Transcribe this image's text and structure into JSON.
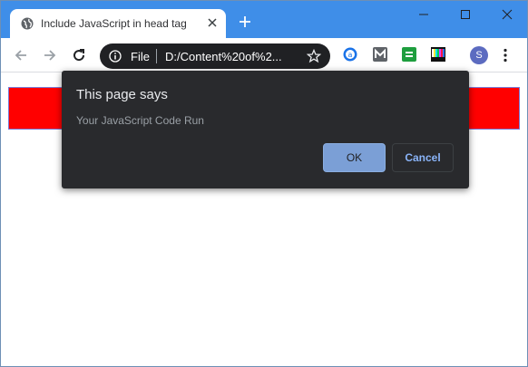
{
  "tab": {
    "title": "Include JavaScript in head tag"
  },
  "address_bar": {
    "scheme_label": "File",
    "url": "D:/Content%20of%2..."
  },
  "profile": {
    "initial": "S"
  },
  "dialog": {
    "title": "This page says",
    "message": "Your JavaScript Code Run",
    "ok_label": "OK",
    "cancel_label": "Cancel"
  },
  "colors": {
    "titlebar": "#3f8ee8",
    "page_bar": "#ff0000",
    "dialog_bg": "#292a2d",
    "ok_button": "#7b9fd6",
    "cancel_text": "#8ab4f8"
  },
  "icons": [
    "globe-icon",
    "close-icon",
    "plus-icon",
    "minimize-icon",
    "maximize-icon",
    "back-arrow-icon",
    "forward-arrow-icon",
    "reload-icon",
    "info-icon",
    "star-icon",
    "extension-icons",
    "more-menu-icon"
  ]
}
